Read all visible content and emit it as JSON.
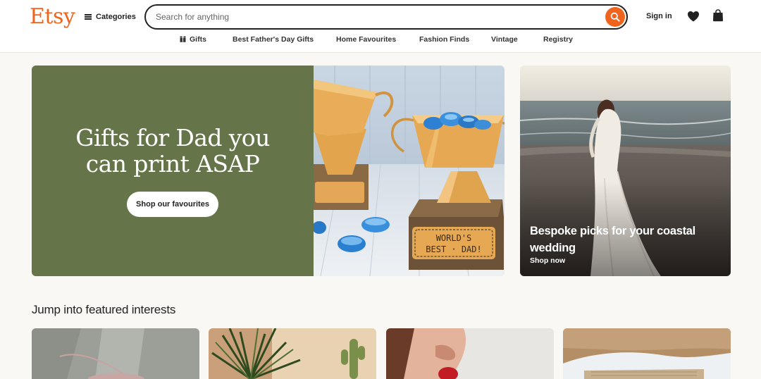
{
  "header": {
    "logo": "Etsy",
    "categories_label": "Categories",
    "search_placeholder": "Search for anything",
    "sign_in": "Sign in"
  },
  "nav": {
    "items": [
      "Gifts",
      "Best Father's Day Gifts",
      "Home Favourites",
      "Fashion Finds",
      "Vintage",
      "Registry"
    ]
  },
  "hero": {
    "title_line1": "Gifts for Dad you",
    "title_line2": "can print ASAP",
    "cta": "Shop our favourites",
    "trophy_text_line1": "WORLD'S",
    "trophy_text_line2": "BEST · DAD!"
  },
  "side_card": {
    "title": "Bespoke picks for your coastal wedding",
    "cta": "Shop now"
  },
  "featured": {
    "heading": "Jump into featured interests"
  },
  "colors": {
    "brand_orange": "#f1641e",
    "hero_green": "#667549",
    "page_background": "#faf8f5"
  },
  "icons": [
    "menu-icon",
    "search-icon",
    "heart-icon",
    "shopping-bag-icon",
    "gift-icon"
  ]
}
